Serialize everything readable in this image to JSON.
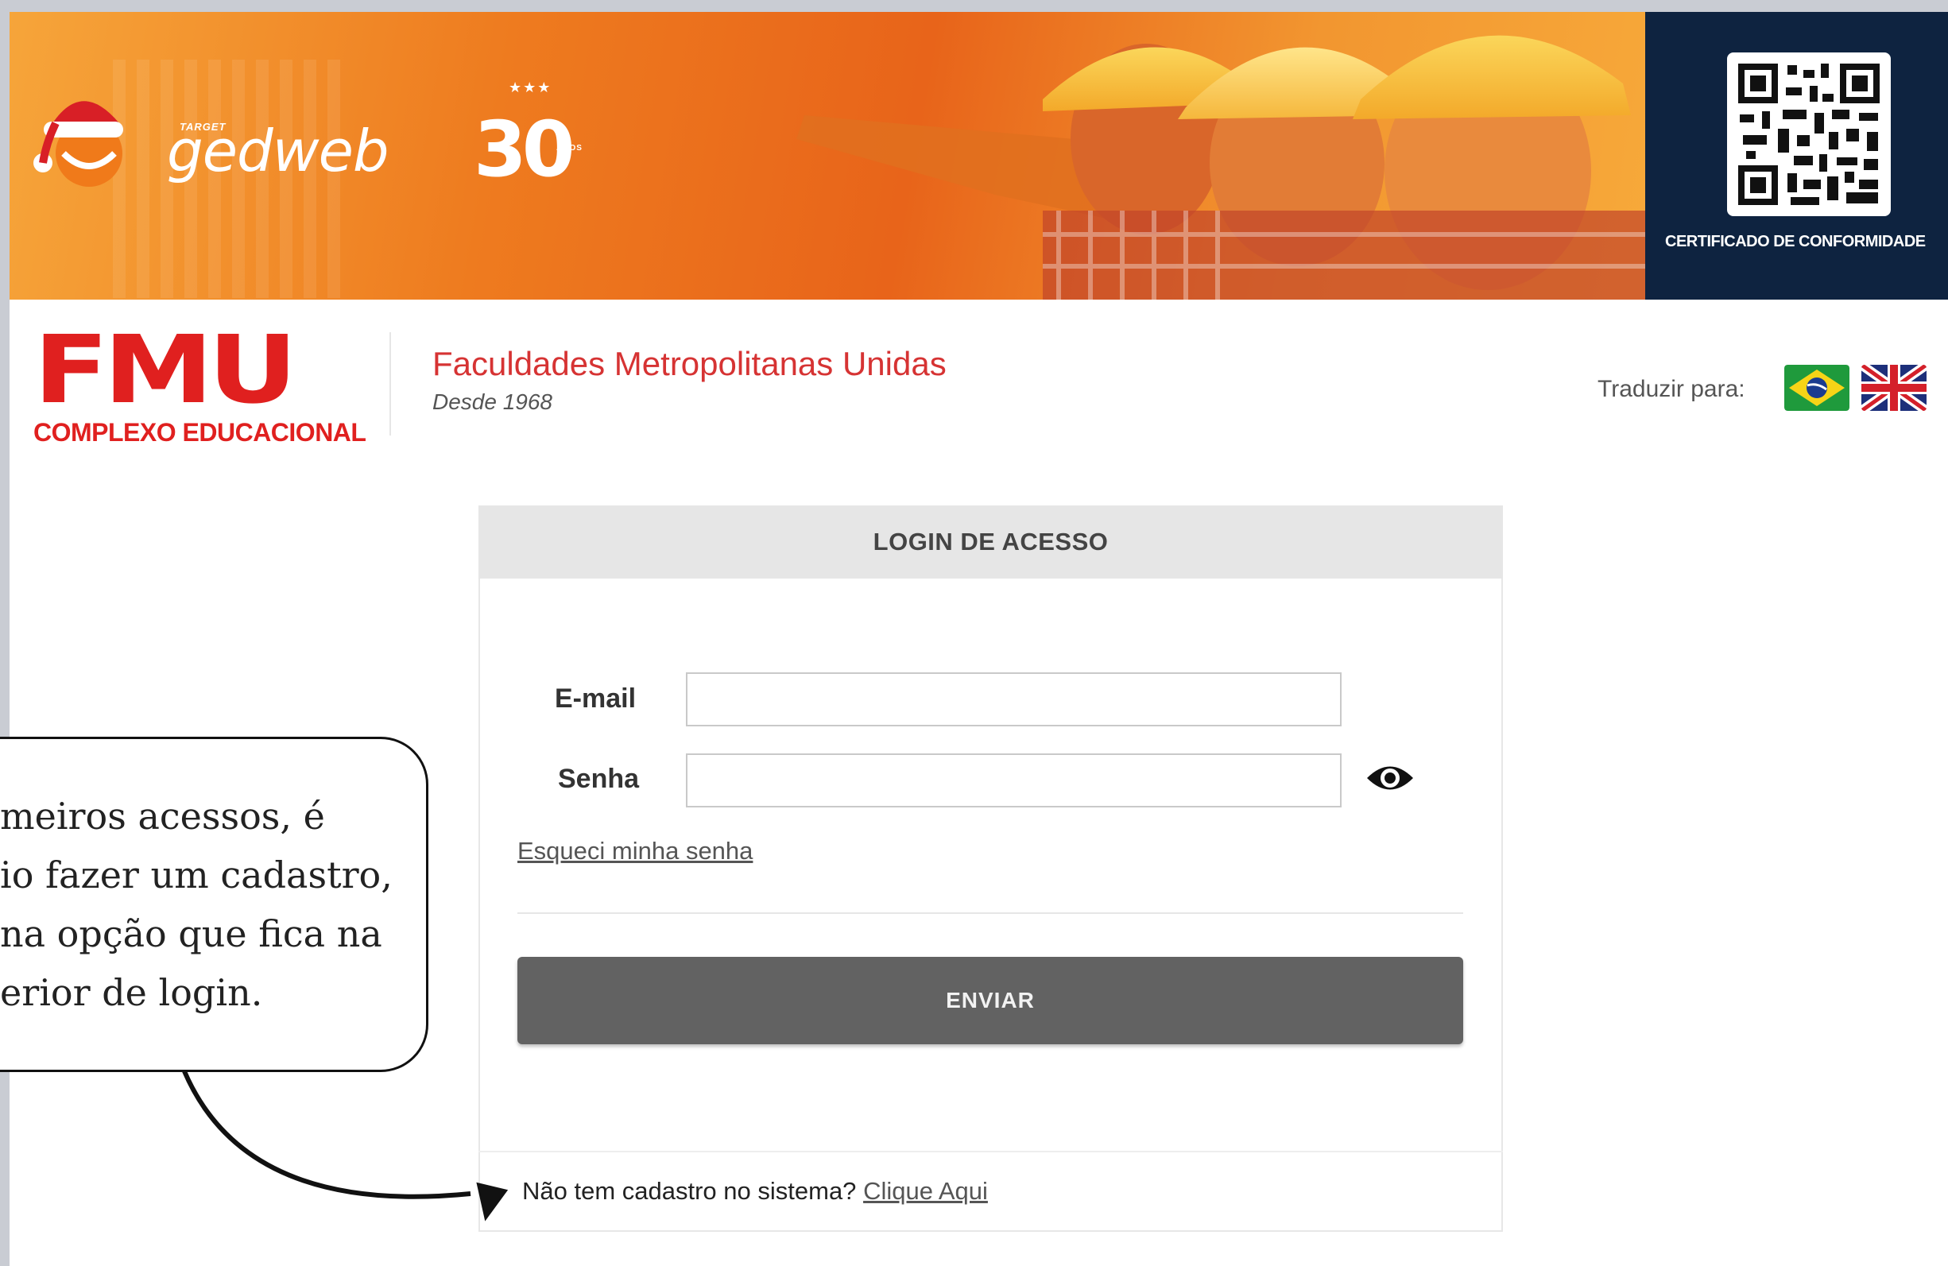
{
  "banner": {
    "brand_small": "TARGET",
    "brand_name": "gedweb",
    "anniversary_number": "30",
    "anniversary_suffix": "ANOS",
    "anniversary_stars": "★★★",
    "certificate_label": "CERTIFICADO DE CONFORMIDADE"
  },
  "header": {
    "logo_text": "FMU",
    "logo_subtitle": "COMPLEXO EDUCACIONAL",
    "institution_name": "Faculdades Metropolitanas Unidas",
    "institution_since": "Desde 1968",
    "translate_label": "Traduzir para:"
  },
  "login": {
    "title": "LOGIN DE ACESSO",
    "email_label": "E-mail",
    "email_value": "",
    "password_label": "Senha",
    "password_value": "",
    "forgot_link": "Esqueci minha senha",
    "submit_label": "ENVIAR",
    "register_prompt": "Não tem cadastro no sistema?",
    "register_link": "Clique Aqui"
  },
  "callout": {
    "lines": [
      "meiros acessos, é",
      "io fazer um cadastro,",
      " na opção que fica na",
      "erior de login."
    ]
  },
  "colors": {
    "brand_red": "#e0201f",
    "banner_orange": "#ee7b1f",
    "certificate_navy": "#0e2340",
    "submit_gray": "#626262"
  }
}
